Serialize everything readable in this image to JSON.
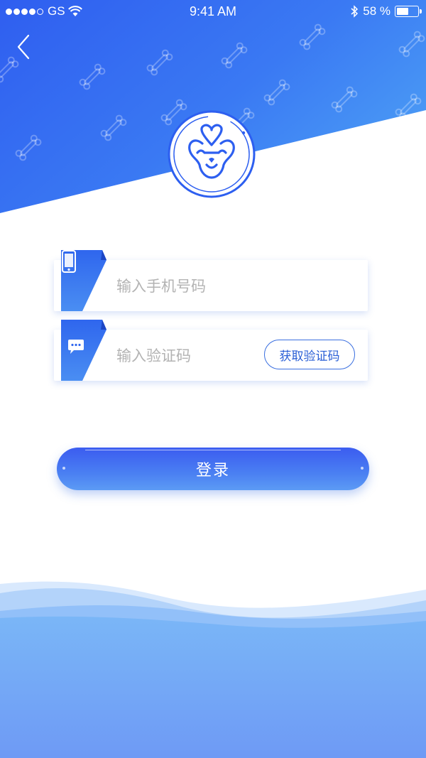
{
  "status_bar": {
    "carrier": "GS",
    "time": "9:41 AM",
    "battery": "58 %",
    "battery_level": 0.58
  },
  "form": {
    "phone_placeholder": "输入手机号码",
    "code_placeholder": "输入验证码",
    "get_code_label": "获取验证码",
    "login_label": "登录"
  },
  "icons": {
    "back": "chevron-left-icon",
    "logo": "dog-face-logo",
    "phone": "phone-icon",
    "message": "chat-bubble-icon",
    "signal": "signal-dots-icon",
    "wifi": "wifi-icon",
    "bluetooth": "bluetooth-icon",
    "battery": "battery-icon"
  },
  "colors": {
    "primary": "#2f5ef0",
    "primary_light": "#4a9af5",
    "wave": "#7ab0f7"
  }
}
